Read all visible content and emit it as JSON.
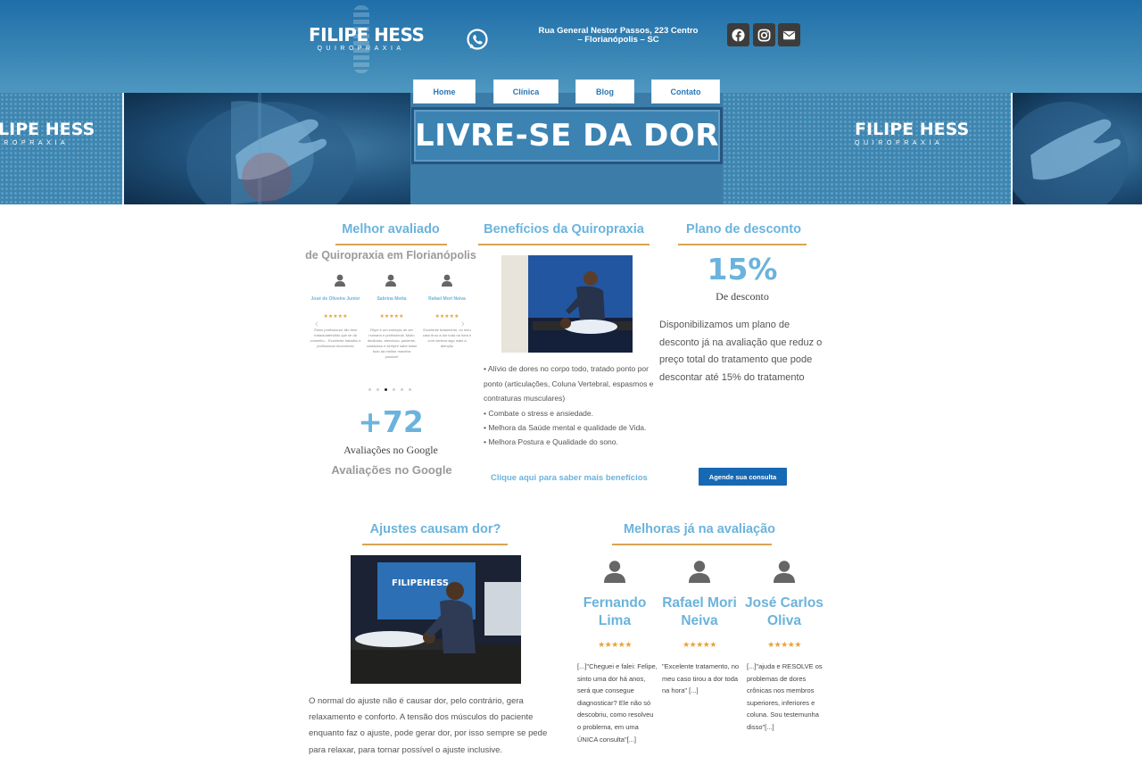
{
  "header": {
    "logo_line1": "FILIPE HESS",
    "logo_line2": "QUIROPRAXIA",
    "address": "Rua General Nestor Passos, 223 Centro – Florianópolis – SC",
    "social": [
      "facebook-icon",
      "instagram-icon",
      "email-icon"
    ]
  },
  "nav": [
    "Home",
    "Clínica",
    "Blog",
    "Contato"
  ],
  "banner": {
    "headline": "LIVRE-SE DA DOR",
    "logo_left_line1": "FILIPE HESS",
    "logo_left_line2": "QUIROPRAXIA",
    "logo_right_line1": "FILIPE HESS",
    "logo_right_line2": "QUIROPRAXIA"
  },
  "best_rated": {
    "title": "Melhor avaliado",
    "subtitle": "de Quiropraxia em Florianópolis",
    "carousel": [
      {
        "name": "José de Oliveira Junior",
        "stars": "★★★★★",
        "text": "Ótimo profissional, tão bem tratado/atendido que se dá conselho... Excelente trabalho e profissional recomendo"
      },
      {
        "name": "Sabrina Motta",
        "stars": "★★★★★",
        "text": "Filipe é um exemplo de ser humano e profissional. Muito dedicado, atencioso, paciente, cuidadoso e sempre sabe tratar tudo da melhor maneira possível"
      },
      {
        "name": "Rafael Mori Neiva",
        "stars": "★★★★★",
        "text": "Excelente tratamento, no meu caso tirou a dor toda na hora e com certeza sigo mais a atenção"
      }
    ],
    "count": "+72",
    "count_label": "Avaliações no Google",
    "count_label_bold": "Avaliações no Google"
  },
  "benefits": {
    "title": "Benefícios da Quiropraxia",
    "items": [
      "• Alívio de dores no corpo todo, tratado ponto por ponto (articulações, Coluna Vertebral, espasmos e contraturas musculares)",
      "• Combate o stress e ansiedade.",
      "• Melhora da Saúde mental e qualidade de Vida.",
      "• Melhora Postura e Qualidade do sono."
    ],
    "link": "Clique aqui para saber mais benefícios"
  },
  "discount": {
    "title": "Plano de desconto",
    "value": "15%",
    "label": "De desconto",
    "text": "Disponibilizamos um plano de desconto já na avaliação que reduz o preço total do tratamento que pode descontar até 15% do tratamento",
    "cta": "Agende sua consulta"
  },
  "adjust": {
    "title": "Ajustes causam dor?",
    "photo_logo": "FILIPEHESS",
    "text": "O normal do ajuste não é causar dor, pelo contrário, gera relaxamento e conforto. A tensão dos músculos do paciente enquanto faz o ajuste, pode gerar dor, por isso sempre se pede para relaxar, para tornar possível o ajuste inclusive."
  },
  "improvements": {
    "title": "Melhoras já na avaliação",
    "reviews": [
      {
        "name": "Fernando Lima",
        "stars": "★★★★★",
        "text": "[...]\"Cheguei e falei: Felipe, sinto uma dor há anos, será que consegue diagnosticar? Ele não só descobriu, como resolveu o problema, em uma ÚNICA consulta\"[...]"
      },
      {
        "name": "Rafael Mori Neiva",
        "stars": "★★★★★",
        "text": "\"Excelente tratamento, no meu caso tirou a dor toda na hora\" [...]"
      },
      {
        "name": "José Carlos Oliva",
        "stars": "★★★★★",
        "text": "[...]\"ajuda e RESOLVE os problemas de dores crônicas nos membros superiores, inferiores e coluna. Sou testemunha disso\"[...]"
      }
    ]
  },
  "colors": {
    "accent": "#6bb3dc",
    "header": "#2a77b6",
    "gold": "#d6a552",
    "cta": "#1769b4"
  }
}
